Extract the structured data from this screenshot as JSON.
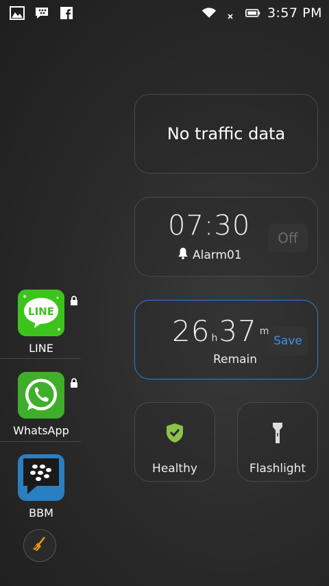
{
  "status_bar": {
    "left_icons": [
      "gallery-icon",
      "bbm-notification-icon",
      "facebook-icon"
    ],
    "right_icons": [
      "wifi-icon",
      "no-signal-icon",
      "battery-icon"
    ],
    "time": "3:57 PM"
  },
  "traffic_card": {
    "text": "No traffic data"
  },
  "alarm_card": {
    "time": "07:30",
    "label": "Alarm01",
    "toggle_label": "Off"
  },
  "remain_card": {
    "hours": "26",
    "hours_unit": "h",
    "minutes": "37",
    "minutes_unit": "m",
    "label": "Remain",
    "action_label": "Save"
  },
  "healthy_card": {
    "label": "Healthy"
  },
  "flashlight_card": {
    "label": "Flashlight"
  },
  "apps": [
    {
      "name": "LINE",
      "locked": true
    },
    {
      "name": "WhatsApp",
      "locked": true
    },
    {
      "name": "BBM",
      "locked": false
    }
  ],
  "colors": {
    "accent_blue": "#2f7fd0",
    "save_blue": "#3a93e6",
    "line_green": "#3cc41c",
    "whatsapp_green": "#3fae2a",
    "shield_green": "#8bc34a",
    "broom_orange": "#f39c12"
  }
}
